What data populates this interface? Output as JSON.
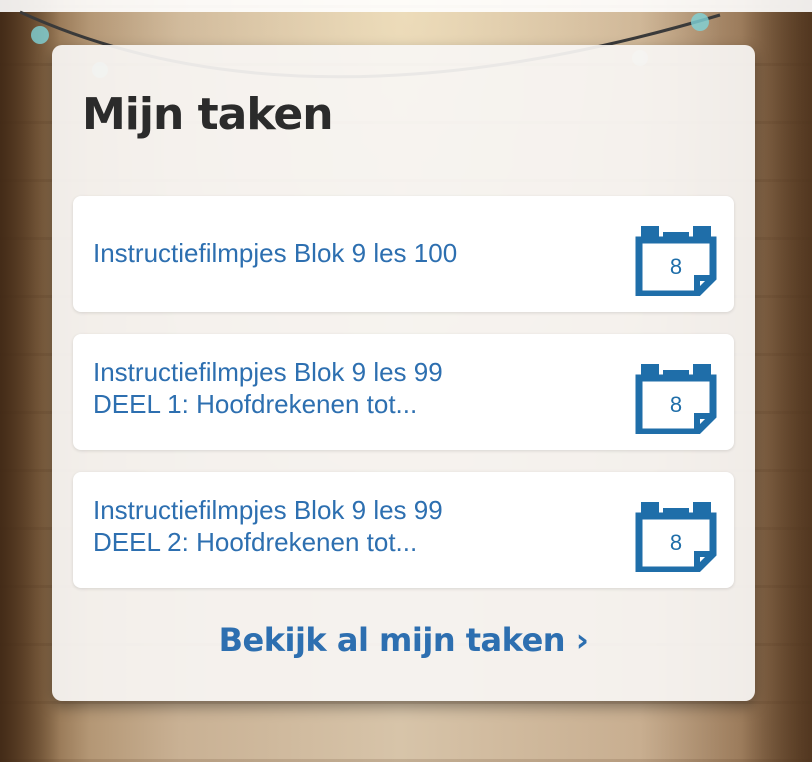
{
  "widget": {
    "title": "Mijn taken",
    "view_all_label": "Bekijk al mijn taken ›"
  },
  "tasks": [
    {
      "lines": [
        "Instructiefilmpjes Blok 9 les 100"
      ],
      "calendar_day": "8"
    },
    {
      "lines": [
        "Instructiefilmpjes Blok 9 les 99",
        "DEEL 1: Hoofdrekenen tot..."
      ],
      "calendar_day": "8"
    },
    {
      "lines": [
        "Instructiefilmpjes Blok 9 les 99",
        "DEEL 2: Hoofdrekenen tot..."
      ],
      "calendar_day": "8"
    }
  ],
  "colors": {
    "accent": "#2d6fb0",
    "calendar_icon": "#1f6ea9",
    "title": "#2b2b2b",
    "panel_bg": "#f7f5f3"
  },
  "icons": {
    "task_icon": "calendar-icon"
  }
}
